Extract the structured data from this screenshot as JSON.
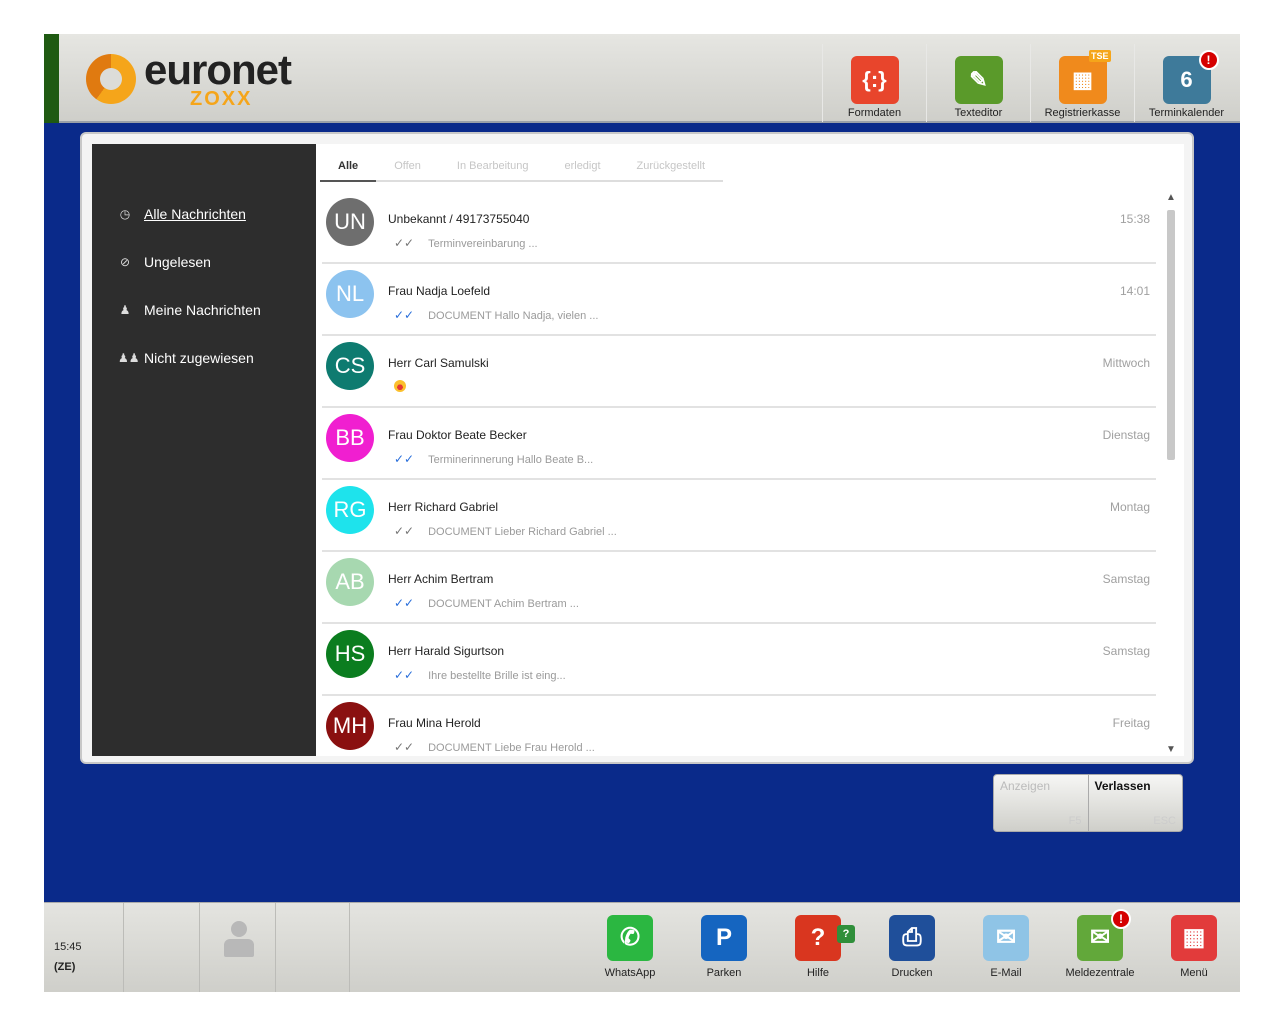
{
  "logo": {
    "name": "euronet",
    "sub": "ZOXX"
  },
  "toolbar": [
    {
      "label": "Formdaten",
      "icon": "formdaten-icon",
      "glyph": "{:}",
      "color": "#e8452c"
    },
    {
      "label": "Texteditor",
      "icon": "texteditor-icon",
      "glyph": "✎",
      "color": "#5a9a2a"
    },
    {
      "label": "Registrierkasse",
      "icon": "registrierkasse-icon",
      "glyph": "▦",
      "color": "#f08a1c",
      "tag": "TSE"
    },
    {
      "label": "Terminkalender",
      "icon": "terminkalender-icon",
      "glyph": "6",
      "color": "#3e7a9a",
      "badge": "!"
    }
  ],
  "sidebar": {
    "items": [
      {
        "label": "Alle Nachrichten",
        "icon": "whatsapp-icon",
        "glyph": "◷",
        "active": true
      },
      {
        "label": "Ungelesen",
        "icon": "unread-icon",
        "glyph": "⊘"
      },
      {
        "label": "Meine Nachrichten",
        "icon": "person-icon",
        "glyph": "♟"
      },
      {
        "label": "Nicht zugewiesen",
        "icon": "group-icon",
        "glyph": "♟♟"
      }
    ]
  },
  "tabs": [
    {
      "label": "Alle",
      "active": true
    },
    {
      "label": "Offen"
    },
    {
      "label": "In Bearbeitung"
    },
    {
      "label": "erledigt"
    },
    {
      "label": "Zurückgestellt"
    }
  ],
  "messages": [
    {
      "initials": "UN",
      "color": "#6e6e6e",
      "name": "Unbekannt / 49173755040",
      "time": "15:38",
      "ticks": "grey",
      "preview": "Terminvereinbarung ..."
    },
    {
      "initials": "NL",
      "color": "#8cc3ef",
      "name": "Frau Nadja Loefeld",
      "time": "14:01",
      "ticks": "blue",
      "preview": "DOCUMENT Hallo Nadja, vielen ..."
    },
    {
      "initials": "CS",
      "color": "#0e7b70",
      "name": "Herr Carl Samulski",
      "time": "Mittwoch",
      "ticks": "none",
      "preview": "",
      "emoji": true
    },
    {
      "initials": "BB",
      "color": "#f01fd0",
      "name": "Frau Doktor Beate Becker",
      "time": "Dienstag",
      "ticks": "blue",
      "preview": "Terminerinnerung Hallo Beate B..."
    },
    {
      "initials": "RG",
      "color": "#1ee3ec",
      "name": "Herr Richard Gabriel",
      "time": "Montag",
      "ticks": "grey",
      "preview": "DOCUMENT Lieber Richard Gabriel ..."
    },
    {
      "initials": "AB",
      "color": "#a7d8b0",
      "name": "Herr Achim Bertram",
      "time": "Samstag",
      "ticks": "blue",
      "preview": "DOCUMENT Achim Bertram ..."
    },
    {
      "initials": "HS",
      "color": "#0b7d1f",
      "name": "Herr Harald Sigurtson",
      "time": "Samstag",
      "ticks": "blue",
      "preview": "Ihre bestellte Brille ist eing..."
    },
    {
      "initials": "MH",
      "color": "#8a1010",
      "name": "Frau Mina Herold",
      "time": "Freitag",
      "ticks": "grey",
      "preview": "DOCUMENT Liebe Frau Herold ..."
    }
  ],
  "actions": [
    {
      "label": "Anzeigen",
      "key": "F5"
    },
    {
      "label": "Verlassen",
      "key": "ESC",
      "primary": true
    }
  ],
  "footer": {
    "time": "15:45",
    "mode": "(ZE)",
    "tools": [
      {
        "label": "WhatsApp",
        "icon": "whatsapp-icon",
        "glyph": "✆",
        "color": "#2bb741"
      },
      {
        "label": "Parken",
        "icon": "parking-icon",
        "glyph": "P",
        "color": "#1565c0"
      },
      {
        "label": "Hilfe",
        "icon": "help-icon",
        "glyph": "?",
        "color": "#d9361f",
        "tag": "?"
      },
      {
        "label": "Drucken",
        "icon": "printer-icon",
        "glyph": "⎙",
        "color": "#1f4f9a"
      },
      {
        "label": "E-Mail",
        "icon": "mail-icon",
        "glyph": "✉",
        "color": "#8fc4e6"
      },
      {
        "label": "Meldezentrale",
        "icon": "message-center-icon",
        "glyph": "✉",
        "color": "#62a83a",
        "badge": "!"
      },
      {
        "label": "Menü",
        "icon": "menu-grid-icon",
        "glyph": "▦",
        "color": "#e23b3b"
      }
    ]
  }
}
